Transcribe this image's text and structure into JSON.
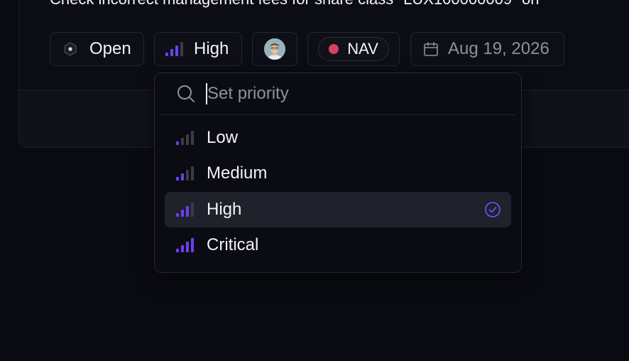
{
  "issue": {
    "title": "Check incorrect management fees for share class \"LUX100000009\" on"
  },
  "chips": {
    "status": {
      "label": "Open",
      "icon": "hexagon-status-icon"
    },
    "priority": {
      "label": "High",
      "level": 3,
      "icon": "signal-bars-icon"
    },
    "assignee": {
      "icon": "avatar"
    },
    "team": {
      "label": "NAV",
      "color": "#d9405e"
    },
    "due_date": {
      "label": "Aug 19, 2026",
      "icon": "calendar-icon"
    }
  },
  "priority_menu": {
    "search_placeholder": "Set priority",
    "search_value": "",
    "options": [
      {
        "label": "Low",
        "level": 1,
        "selected": false
      },
      {
        "label": "Medium",
        "level": 2,
        "selected": false
      },
      {
        "label": "High",
        "level": 3,
        "selected": true
      },
      {
        "label": "Critical",
        "level": 4,
        "selected": false
      }
    ]
  },
  "colors": {
    "accent": "#6b3ff2",
    "accent_check": "#6a4cf0",
    "bar_inactive": "#3a3c46",
    "background": "#0a0b12"
  }
}
